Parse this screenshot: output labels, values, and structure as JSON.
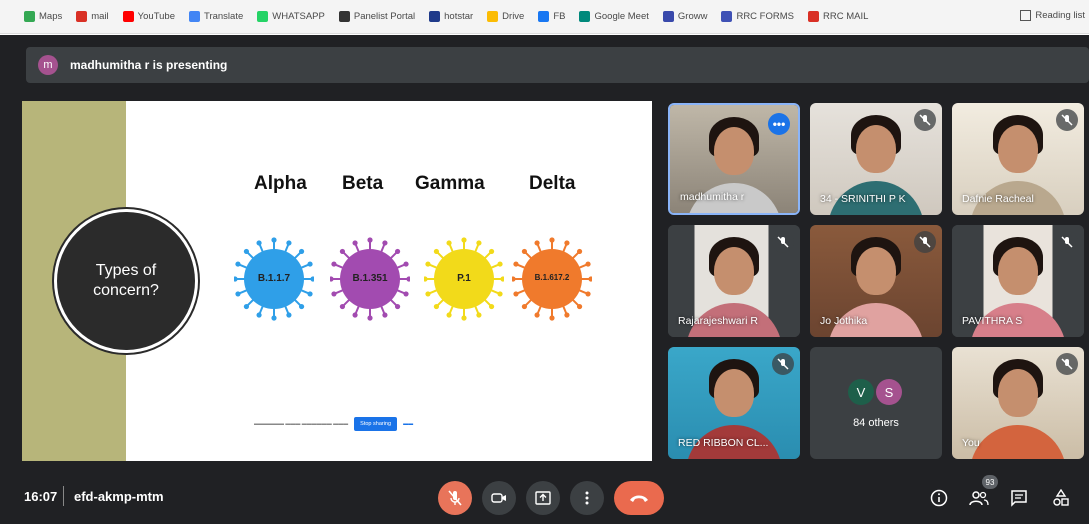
{
  "bookmarks": [
    {
      "label": "Maps",
      "icon": "maps-pin-icon",
      "color": "#34a853"
    },
    {
      "label": "mail",
      "icon": "gmail-icon",
      "color": "#d93025"
    },
    {
      "label": "YouTube",
      "icon": "youtube-icon",
      "color": "#ff0000"
    },
    {
      "label": "Translate",
      "icon": "translate-icon",
      "color": "#4285f4"
    },
    {
      "label": "WHATSAPP",
      "icon": "whatsapp-icon",
      "color": "#25d366"
    },
    {
      "label": "Panelist Portal",
      "icon": "panelist-portal-icon",
      "color": "#333333"
    },
    {
      "label": "hotstar",
      "icon": "hotstar-icon",
      "color": "#1f3a8a"
    },
    {
      "label": "Drive",
      "icon": "drive-icon",
      "color": "#fbbc04"
    },
    {
      "label": "FB",
      "icon": "facebook-icon",
      "color": "#1877f2"
    },
    {
      "label": "Google Meet",
      "icon": "google-meet-icon",
      "color": "#00897b"
    },
    {
      "label": "Groww",
      "icon": "groww-icon",
      "color": "#3949ab"
    },
    {
      "label": "RRC FORMS",
      "icon": "forms-icon",
      "color": "#3f51b5"
    },
    {
      "label": "RRC MAIL",
      "icon": "gmail-icon",
      "color": "#d93025"
    }
  ],
  "reading_list": "Reading list",
  "presenting": {
    "avatar_letter": "m",
    "text": "madhumitha r is presenting"
  },
  "slide": {
    "circle_text_line1": "Types of",
    "circle_text_line2": "concern?",
    "variants": [
      {
        "name": "Alpha",
        "code": "B.1.1.7",
        "color": "#2f9fe8",
        "spike_color": "#2f9fe8"
      },
      {
        "name": "Beta",
        "code": "B.1.351",
        "color": "#a24bb0",
        "spike_color": "#a24bb0"
      },
      {
        "name": "Gamma",
        "code": "P.1",
        "color": "#f2da1a",
        "spike_color": "#f2da1a"
      },
      {
        "name": "Delta",
        "code": "B.1.617.2",
        "color": "#f07a2c",
        "spike_color": "#f07a2c"
      }
    ],
    "stop_sharing_label": "Stop sharing"
  },
  "participants": [
    {
      "name": "madhumitha r"
    },
    {
      "name": "34 - SRINITHI P K"
    },
    {
      "name": "Dafnie Racheal"
    },
    {
      "name": "Rajarajeshwari R"
    },
    {
      "name": "Jo Jothika"
    },
    {
      "name": "PAVITHRA S"
    },
    {
      "name": "RED RIBBON CL..."
    },
    {
      "name": "You"
    }
  ],
  "others": {
    "avatar1": "V",
    "avatar2": "S",
    "avatar1_color": "#1e5f4a",
    "avatar2_color": "#a5528f",
    "label": "84 others"
  },
  "bottom_bar": {
    "time": "16:07",
    "meeting_code": "efd-akmp-mtm",
    "people_count": "93"
  }
}
